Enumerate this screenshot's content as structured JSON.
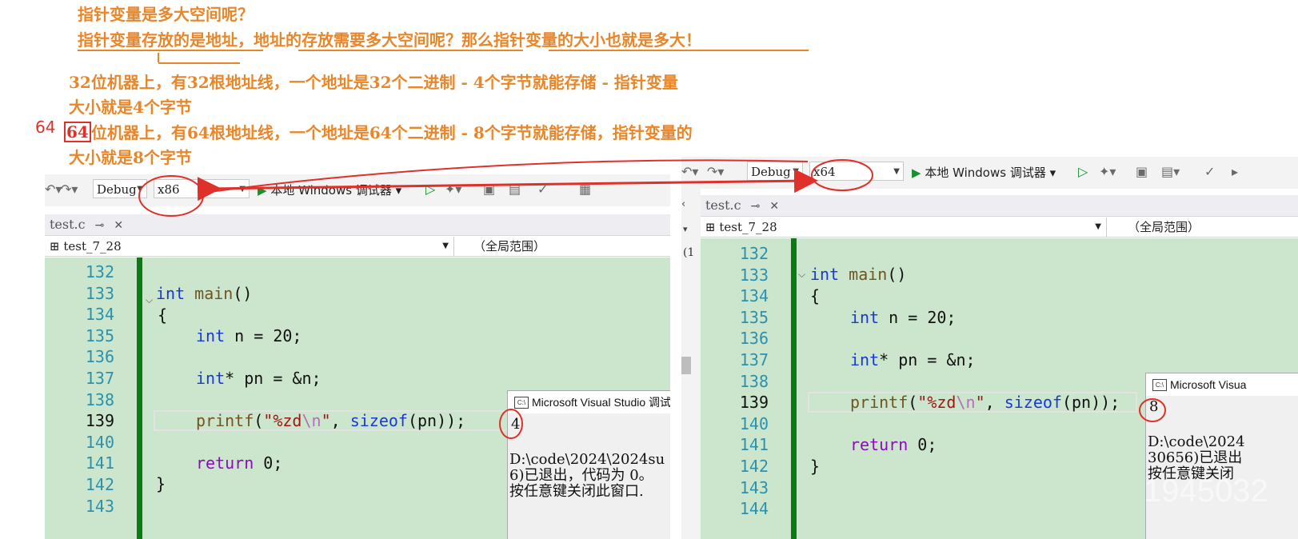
{
  "notes": {
    "q1": "指针变量是多大空间呢？",
    "q2": "指针变量存放的是地址，地址的存放需要多大空间呢？那么指针变量的大小也就是多大！",
    "l32a": "32位机器上，有32根地址线，一个地址是32个二进制 - 4个字节就能存储 - 指针变量",
    "l32b": "大小就是4个字节",
    "l64a": "位机器上，有64根地址线，一个地址是64个二进制 - 8个字节就能存储，指针变量的",
    "l64b": "大小就是8个字节",
    "mark64": "64",
    "box64": "64"
  },
  "left": {
    "toolbar": {
      "config": "Debug",
      "platform": "x86",
      "run_label": "本地 Windows 调试器"
    },
    "tab": {
      "name": "test.c",
      "pin": "⊸",
      "close": "✕"
    },
    "nav": {
      "scope_file": "test_7_28",
      "scope": "（全局范围）"
    },
    "line_numbers": [
      "132",
      "133",
      "134",
      "135",
      "136",
      "137",
      "138",
      "139",
      "140",
      "141",
      "142",
      "143"
    ],
    "code": {
      "l133_kw": "int",
      "l133_fn": "main",
      "l133_rest": "()",
      "l134": "{",
      "l135_kw": "int",
      "l135_rest": " n = 20;",
      "l137_kw": "int",
      "l137_rest": "* pn = &n;",
      "l139_fn": "printf",
      "l139_open": "(",
      "l139_str1": "\"%zd",
      "l139_esc": "\\n",
      "l139_str2": "\"",
      "l139_comma": ", ",
      "l139_sizeof": "sizeof",
      "l139_rest": "(pn));",
      "l141_ret": "return",
      "l141_rest": " 0;",
      "l142": "}"
    },
    "console": {
      "title": "Microsoft Visual Studio 调试",
      "output": "4",
      "path": "D:\\code\\2024\\2024su",
      "exit": "6)已退出，代码为 0。",
      "prompt": "按任意键关闭此窗口."
    }
  },
  "right": {
    "toolbar": {
      "config": "Debug",
      "platform": "x64",
      "run_label": "本地 Windows 调试器"
    },
    "tab": {
      "name": "test.c",
      "pin": "⊸",
      "close": "✕"
    },
    "nav": {
      "scope_file": "test_7_28",
      "scope": "（全局范围）"
    },
    "line_numbers": [
      "132",
      "133",
      "134",
      "135",
      "136",
      "137",
      "138",
      "139",
      "140",
      "141",
      "142",
      "143",
      "144"
    ],
    "code": {
      "l133_kw": "int",
      "l133_fn": "main",
      "l133_rest": "()",
      "l134": "{",
      "l135_kw": "int",
      "l135_rest": " n = 20;",
      "l137_kw": "int",
      "l137_rest": "* pn = &n;",
      "l139_fn": "printf",
      "l139_open": "(",
      "l139_str1": "\"%zd",
      "l139_esc": "\\n",
      "l139_str2": "\"",
      "l139_comma": ", ",
      "l139_sizeof": "sizeof",
      "l139_rest": "(pn));",
      "l141_ret": "return",
      "l141_rest": " 0;",
      "l142": "}"
    },
    "console": {
      "title": "Microsoft Visua",
      "output": "8",
      "path": "D:\\code\\2024",
      "exit": "30656)已退出",
      "prompt": "按任意键关闭"
    },
    "side_marks": [
      "(1"
    ]
  },
  "watermark": "1945032"
}
